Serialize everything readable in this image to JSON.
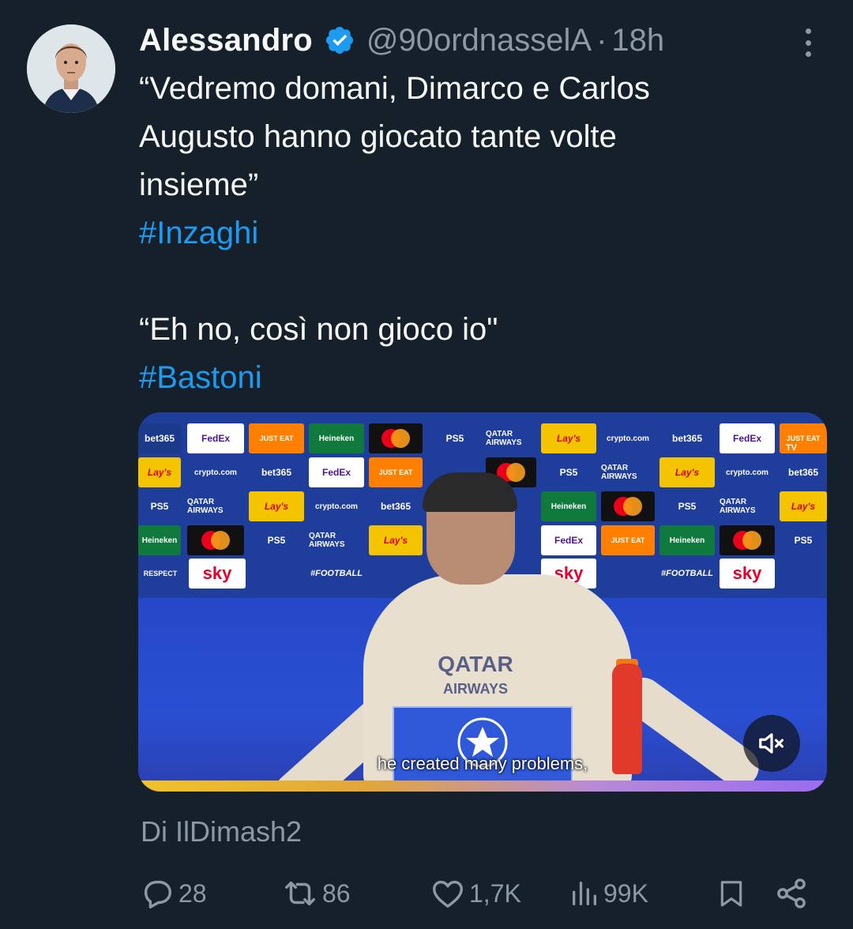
{
  "tweet": {
    "author_name": "Alessandro",
    "handle": "@90ordnasselA",
    "separator": "·",
    "time": "18h",
    "text_lines": [
      "“Vedremo domani, Dimarco e Carlos",
      "Augusto hanno giocato tante volte",
      "insieme”"
    ],
    "hashtag_1": "#Inzaghi",
    "quote_2": "“Eh no, così non gioco io\"",
    "hashtag_2": "#Bastoni",
    "media": {
      "subtitle": "he created many problems,",
      "jersey_text_1": "QATAR",
      "jersey_text_2": "AIRWAYS",
      "channel_badge": "TV",
      "sponsors": [
        "bet365",
        "FedEx",
        "JUST EAT",
        "Heineken",
        "PS5",
        "QATAR AIRWAYS",
        "Lay's",
        "crypto.com",
        "sky",
        "#FOOTBALL",
        "RESPECT"
      ]
    },
    "credit": "Di IlDimash2",
    "stats": {
      "replies": "28",
      "retweets": "86",
      "likes": "1,7K",
      "views": "99K"
    }
  },
  "colors": {
    "background": "#15202b",
    "text": "#f7f9f9",
    "secondary": "#8b98a5",
    "accent": "#1d9bf0"
  },
  "icons": [
    "verified-badge-icon",
    "more-options-icon",
    "reply-icon",
    "retweet-icon",
    "like-icon",
    "views-icon",
    "bookmark-icon",
    "share-icon",
    "mute-icon"
  ]
}
